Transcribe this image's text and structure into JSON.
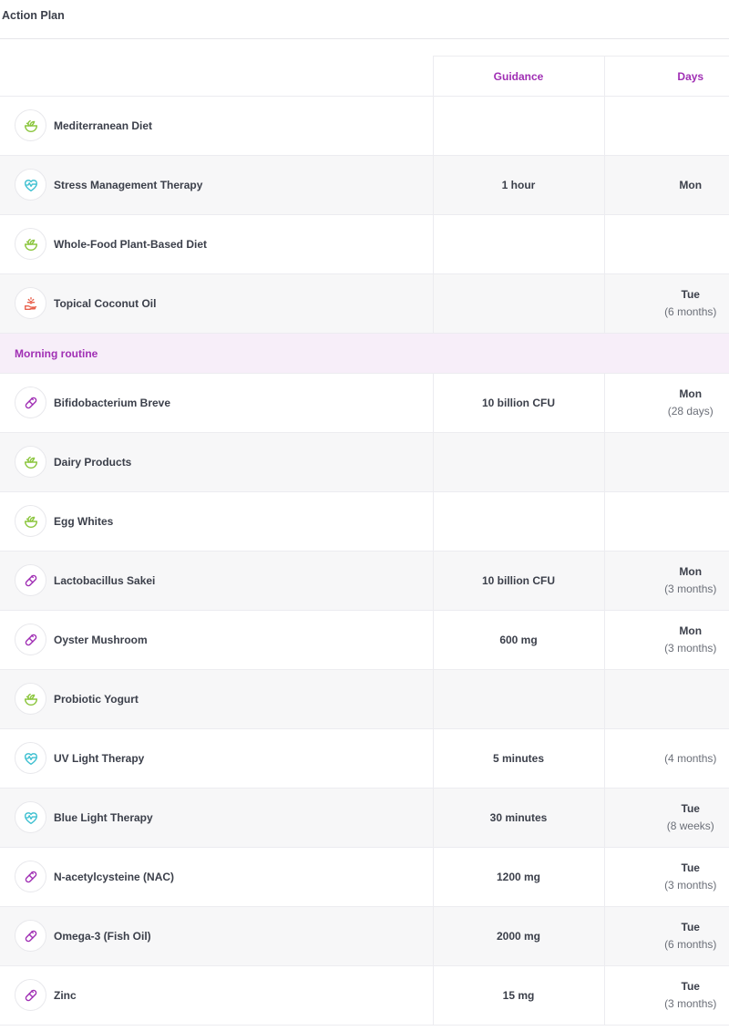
{
  "header": {
    "title": "Action Plan"
  },
  "table": {
    "columns": {
      "name": "",
      "guidance": "Guidance",
      "days": "Days"
    },
    "rows": [
      {
        "kind": "item",
        "icon": "salad-bowl-icon",
        "name": "Mediterranean Diet",
        "guidance": "",
        "day": "",
        "duration": ""
      },
      {
        "kind": "item",
        "icon": "heart-pulse-icon",
        "name": "Stress Management Therapy",
        "guidance": "1 hour",
        "day": "Mon",
        "duration": ""
      },
      {
        "kind": "item",
        "icon": "salad-bowl-icon",
        "name": "Whole-Food Plant-Based Diet",
        "guidance": "",
        "day": "",
        "duration": ""
      },
      {
        "kind": "item",
        "icon": "hand-lotion-icon",
        "name": "Topical Coconut Oil",
        "guidance": "",
        "day": "Tue",
        "duration": "(6 months)"
      },
      {
        "kind": "section",
        "label": "Morning routine"
      },
      {
        "kind": "item",
        "icon": "pill-icon",
        "name": "Bifidobacterium Breve",
        "guidance": "10 billion CFU",
        "day": "Mon",
        "duration": "(28 days)"
      },
      {
        "kind": "item",
        "icon": "salad-bowl-icon",
        "name": "Dairy Products",
        "guidance": "",
        "day": "",
        "duration": ""
      },
      {
        "kind": "item",
        "icon": "salad-bowl-icon",
        "name": "Egg Whites",
        "guidance": "",
        "day": "",
        "duration": ""
      },
      {
        "kind": "item",
        "icon": "pill-icon",
        "name": "Lactobacillus Sakei",
        "guidance": "10 billion CFU",
        "day": "Mon",
        "duration": "(3 months)"
      },
      {
        "kind": "item",
        "icon": "pill-icon",
        "name": "Oyster Mushroom",
        "guidance": "600 mg",
        "day": "Mon",
        "duration": "(3 months)"
      },
      {
        "kind": "item",
        "icon": "salad-bowl-icon",
        "name": "Probiotic Yogurt",
        "guidance": "",
        "day": "",
        "duration": ""
      },
      {
        "kind": "item",
        "icon": "heart-pulse-icon",
        "name": "UV Light Therapy",
        "guidance": "5 minutes",
        "day": "",
        "duration": "(4 months)"
      },
      {
        "kind": "item",
        "icon": "heart-pulse-icon",
        "name": "Blue Light Therapy",
        "guidance": "30 minutes",
        "day": "Tue",
        "duration": "(8 weeks)"
      },
      {
        "kind": "item",
        "icon": "pill-icon",
        "name": "N-acetylcysteine (NAC)",
        "guidance": "1200 mg",
        "day": "Tue",
        "duration": "(3 months)"
      },
      {
        "kind": "item",
        "icon": "pill-icon",
        "name": "Omega-3 (Fish Oil)",
        "guidance": "2000 mg",
        "day": "Tue",
        "duration": "(6 months)"
      },
      {
        "kind": "item",
        "icon": "pill-icon",
        "name": "Zinc",
        "guidance": "15 mg",
        "day": "Tue",
        "duration": "(3 months)"
      }
    ]
  },
  "colors": {
    "accent": "#a02fb4",
    "section_bg": "#f7eef9",
    "diet_icon": "#8cc63f",
    "therapy_icon": "#3bbfd0",
    "topical_icon": "#e8604c",
    "supplement_icon": "#a02fb4"
  }
}
